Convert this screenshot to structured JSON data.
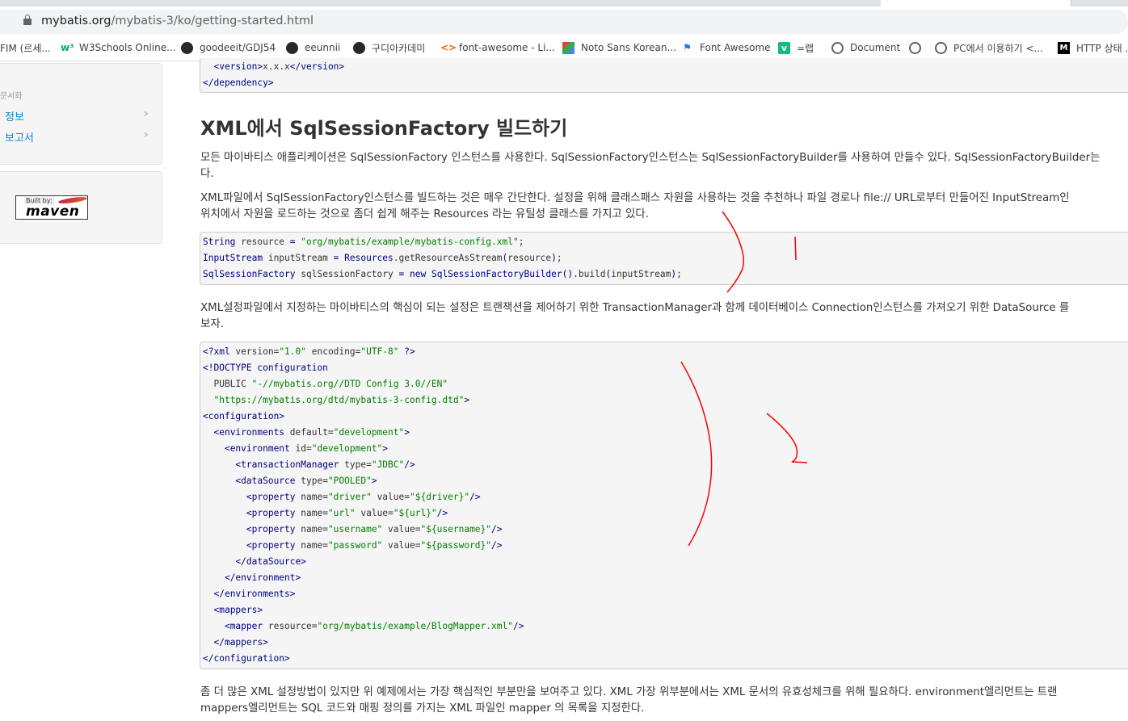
{
  "browser": {
    "url_host": "mybatis.org",
    "url_path": "/mybatis-3/ko/getting-started.html",
    "bookmarks": [
      {
        "label": "FIM (르세...",
        "icon": "none"
      },
      {
        "label": "W3Schools Online...",
        "icon": "w3schools-icon"
      },
      {
        "label": "goodeeit/GDJ54",
        "icon": "github-icon"
      },
      {
        "label": "eeunnii",
        "icon": "github-icon"
      },
      {
        "label": "구디아카데미",
        "icon": "github-icon"
      },
      {
        "label": "font-awesome - Li...",
        "icon": "code-icon"
      },
      {
        "label": "Noto Sans Korean...",
        "icon": "noto-icon"
      },
      {
        "label": "Font Awesome",
        "icon": "flag-icon"
      },
      {
        "label": "=랩",
        "icon": "v-icon"
      },
      {
        "label": "Document",
        "icon": "globe-icon"
      },
      {
        "label": "",
        "icon": "globe-icon"
      },
      {
        "label": "PC에서 이용하기 <...",
        "icon": "globe-icon"
      },
      {
        "label": "HTTP 상태 ...",
        "icon": "m-icon"
      }
    ]
  },
  "sidebar": {
    "header": "문서화",
    "items": [
      {
        "label": "정보"
      },
      {
        "label": "보고서"
      }
    ],
    "maven_badge": {
      "built_by": "Built by:",
      "name": "maven"
    }
  },
  "content": {
    "top_code": [
      {
        "indent": "  ",
        "parts": [
          [
            "tag",
            "<version>"
          ],
          [
            "txt",
            "x.x.x"
          ],
          [
            "tag",
            "</version>"
          ]
        ]
      },
      {
        "indent": "",
        "parts": [
          [
            "tag",
            "</dependency>"
          ]
        ]
      }
    ],
    "heading": "XML에서 SqlSessionFactory 빌드하기",
    "para1_line1": "모든 마이바티스 애플리케이션은 SqlSessionFactory 인스턴스를 사용한다. SqlSessionFactory인스턴스는 SqlSessionFactoryBuilder를 사용하여 만들수 있다. SqlSessionFactoryBuilder는",
    "para1_line2": "다.",
    "para2_line1": "XML파일에서 SqlSessionFactory인스턴스를 빌드하는 것은 매우 간단한다. 설정을 위해 클래스패스 자원을 사용하는 것을 추천하나 파일 경로나 file:// URL로부터 만들어진 InputStream인",
    "para2_line2": "위치에서 자원을 로드하는 것으로 좀더 쉽게 해주는 Resources 라는 유틸성 클래스를 가지고 있다.",
    "java_code": [
      [
        [
          "typ",
          "String"
        ],
        [
          "txt",
          " resource "
        ],
        [
          "kw",
          "="
        ],
        [
          "txt",
          " "
        ],
        [
          "str",
          "\"org/mybatis/example/mybatis-config.xml\""
        ],
        [
          "txt",
          ";"
        ]
      ],
      [
        [
          "typ",
          "InputStream"
        ],
        [
          "txt",
          " inputStream "
        ],
        [
          "kw",
          "="
        ],
        [
          "txt",
          " "
        ],
        [
          "typ",
          "Resources"
        ],
        [
          "txt",
          "."
        ],
        [
          "txt",
          "getResourceAsStream"
        ],
        [
          "kw",
          "("
        ],
        [
          "txt",
          "resource"
        ],
        [
          "kw",
          ")"
        ],
        [
          "txt",
          ";"
        ]
      ],
      [
        [
          "typ",
          "SqlSessionFactory"
        ],
        [
          "txt",
          " sqlSessionFactory "
        ],
        [
          "kw",
          "="
        ],
        [
          "txt",
          " "
        ],
        [
          "kw",
          "new"
        ],
        [
          "txt",
          " "
        ],
        [
          "typ",
          "SqlSessionFactoryBuilder"
        ],
        [
          "kw",
          "()"
        ],
        [
          "txt",
          ".build"
        ],
        [
          "kw",
          "("
        ],
        [
          "txt",
          "inputStream"
        ],
        [
          "kw",
          ")"
        ],
        [
          "txt",
          ";"
        ]
      ]
    ],
    "para3_line1": "XML설정파일에서 지정하는 마이바티스의 핵심이 되는 설정은 트랜잭션을 제어하기 위한 TransactionManager과 함께 데이터베이스 Connection인스턴스를 가져오기 위한 DataSource 를",
    "para3_line2": "보자.",
    "xml_code": [
      [
        [
          "tag",
          "<?xml "
        ],
        [
          "txt",
          "version="
        ],
        [
          "str",
          "\"1.0\""
        ],
        [
          "txt",
          " encoding="
        ],
        [
          "str",
          "\"UTF-8\""
        ],
        [
          "tag",
          " ?>"
        ]
      ],
      [
        [
          "tag",
          "<!DOCTYPE configuration"
        ]
      ],
      [
        [
          "txt",
          "  PUBLIC "
        ],
        [
          "str",
          "\"-//mybatis.org//DTD Config 3.0//EN\""
        ]
      ],
      [
        [
          "txt",
          "  "
        ],
        [
          "str",
          "\"https://mybatis.org/dtd/mybatis-3-config.dtd\""
        ],
        [
          "tag",
          ">"
        ]
      ],
      [
        [
          "tag",
          "<configuration>"
        ]
      ],
      [
        [
          "txt",
          "  "
        ],
        [
          "tag",
          "<environments "
        ],
        [
          "txt",
          "default="
        ],
        [
          "str",
          "\"development\""
        ],
        [
          "tag",
          ">"
        ]
      ],
      [
        [
          "txt",
          "    "
        ],
        [
          "tag",
          "<environment "
        ],
        [
          "txt",
          "id="
        ],
        [
          "str",
          "\"development\""
        ],
        [
          "tag",
          ">"
        ]
      ],
      [
        [
          "txt",
          "      "
        ],
        [
          "tag",
          "<transactionManager "
        ],
        [
          "txt",
          "type="
        ],
        [
          "str",
          "\"JDBC\""
        ],
        [
          "tag",
          "/>"
        ]
      ],
      [
        [
          "txt",
          "      "
        ],
        [
          "tag",
          "<dataSource "
        ],
        [
          "txt",
          "type="
        ],
        [
          "str",
          "\"POOLED\""
        ],
        [
          "tag",
          ">"
        ]
      ],
      [
        [
          "txt",
          "        "
        ],
        [
          "tag",
          "<property "
        ],
        [
          "txt",
          "name="
        ],
        [
          "str",
          "\"driver\""
        ],
        [
          "txt",
          " value="
        ],
        [
          "str",
          "\"${driver}\""
        ],
        [
          "tag",
          "/>"
        ]
      ],
      [
        [
          "txt",
          "        "
        ],
        [
          "tag",
          "<property "
        ],
        [
          "txt",
          "name="
        ],
        [
          "str",
          "\"url\""
        ],
        [
          "txt",
          " value="
        ],
        [
          "str",
          "\"${url}\""
        ],
        [
          "tag",
          "/>"
        ]
      ],
      [
        [
          "txt",
          "        "
        ],
        [
          "tag",
          "<property "
        ],
        [
          "txt",
          "name="
        ],
        [
          "str",
          "\"username\""
        ],
        [
          "txt",
          " value="
        ],
        [
          "str",
          "\"${username}\""
        ],
        [
          "tag",
          "/>"
        ]
      ],
      [
        [
          "txt",
          "        "
        ],
        [
          "tag",
          "<property "
        ],
        [
          "txt",
          "name="
        ],
        [
          "str",
          "\"password\""
        ],
        [
          "txt",
          " value="
        ],
        [
          "str",
          "\"${password}\""
        ],
        [
          "tag",
          "/>"
        ]
      ],
      [
        [
          "txt",
          "      "
        ],
        [
          "tag",
          "</dataSource>"
        ]
      ],
      [
        [
          "txt",
          "    "
        ],
        [
          "tag",
          "</environment>"
        ]
      ],
      [
        [
          "txt",
          "  "
        ],
        [
          "tag",
          "</environments>"
        ]
      ],
      [
        [
          "txt",
          "  "
        ],
        [
          "tag",
          "<mappers>"
        ]
      ],
      [
        [
          "txt",
          "    "
        ],
        [
          "tag",
          "<mapper "
        ],
        [
          "txt",
          "resource="
        ],
        [
          "str",
          "\"org/mybatis/example/BlogMapper.xml\""
        ],
        [
          "tag",
          "/>"
        ]
      ],
      [
        [
          "txt",
          "  "
        ],
        [
          "tag",
          "</mappers>"
        ]
      ],
      [
        [
          "tag",
          "</configuration>"
        ]
      ]
    ],
    "para4_line1": "좀 더 많은 XML 설정방법이 있지만 위 예제에서는 가장 핵심적인 부분만을 보여주고 있다. XML 가장 위부분에서는 XML 문서의 유효성체크를 위해 필요하다. environment엘리먼트는 트랜",
    "para4_line2": "mappers엘리먼트는 SQL 코드와 매핑 정의를 가지는 XML 파일인 mapper 의 목록을 지정한다."
  },
  "colors": {
    "link": "#0088cc",
    "code_bg": "#f5f5f5",
    "code_tag": "#000080",
    "code_string": "#008000",
    "annotation_pen": "#ff0000"
  }
}
